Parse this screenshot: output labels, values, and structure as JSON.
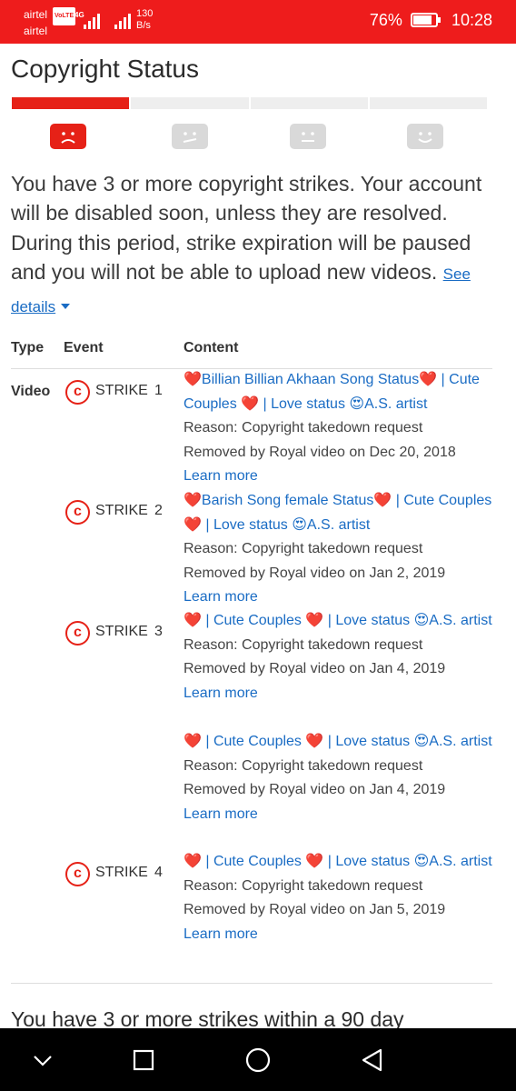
{
  "status_bar": {
    "carrier_1": "airtel",
    "carrier_2": "airtel",
    "volte": "VoLTE",
    "network": "4G",
    "speed_value": "130",
    "speed_unit": "B/s",
    "battery_pct": "76%",
    "time": "10:28"
  },
  "page": {
    "title": "Copyright Status",
    "status_step_active": 1,
    "status_faces": [
      "sad-face-icon",
      "unhappy-face-icon",
      "neutral-face-icon",
      "happy-face-icon"
    ],
    "description": "You have 3 or more copyright strikes. Your account will be disabled soon, unless they are resolved. During this period, strike expiration will be paused and you will not be able to upload new videos.",
    "see_details": "See details"
  },
  "table": {
    "headers": {
      "type": "Type",
      "event": "Event",
      "content": "Content"
    },
    "type_value": "Video",
    "strike_label": "STRIKE",
    "strikes": [
      {
        "number": "1"
      },
      {
        "number": "2"
      },
      {
        "number": "3"
      },
      {
        "number": "4"
      }
    ],
    "entries": [
      {
        "title": "❤️Billian Billian Akhaan Song Status❤️ | Cute Couples ❤️ | Love status 😍A.S. artist",
        "reason": "Reason: Copyright takedown request",
        "removed": "Removed by Royal video on Dec 20, 2018",
        "learn": "Learn more"
      },
      {
        "title": "❤️Barish Song female Status❤️ | Cute Couples ❤️ | Love status 😍A.S. artist",
        "reason": "Reason: Copyright takedown request",
        "removed": "Removed by Royal video on Jan 2, 2019",
        "learn": "Learn more"
      },
      {
        "title": "❤️ | Cute Couples ❤️ | Love status 😍A.S. artist",
        "reason": "Reason: Copyright takedown request",
        "removed": "Removed by Royal video on Jan 4, 2019",
        "learn": "Learn more"
      },
      {
        "title": "❤️ | Cute Couples ❤️ | Love status 😍A.S. artist",
        "reason": "Reason: Copyright takedown request",
        "removed": "Removed by Royal video on Jan 4, 2019",
        "learn": "Learn more"
      },
      {
        "title": "❤️ | Cute Couples ❤️ | Love status 😍A.S. artist",
        "reason": "Reason: Copyright takedown request",
        "removed": "Removed by Royal video on Jan 5, 2019",
        "learn": "Learn more"
      }
    ]
  },
  "footer": {
    "partial_text": "You have 3 or more strikes within a 90 day"
  },
  "navbar": {
    "buttons": [
      "chevron-down-icon",
      "recents-square-icon",
      "home-circle-icon",
      "back-triangle-icon"
    ]
  },
  "colors": {
    "status_bar": "#ee1c1c",
    "accent_red": "#e62117",
    "link_blue": "#1a6cc4",
    "inactive_gray": "#d9d9d9"
  }
}
